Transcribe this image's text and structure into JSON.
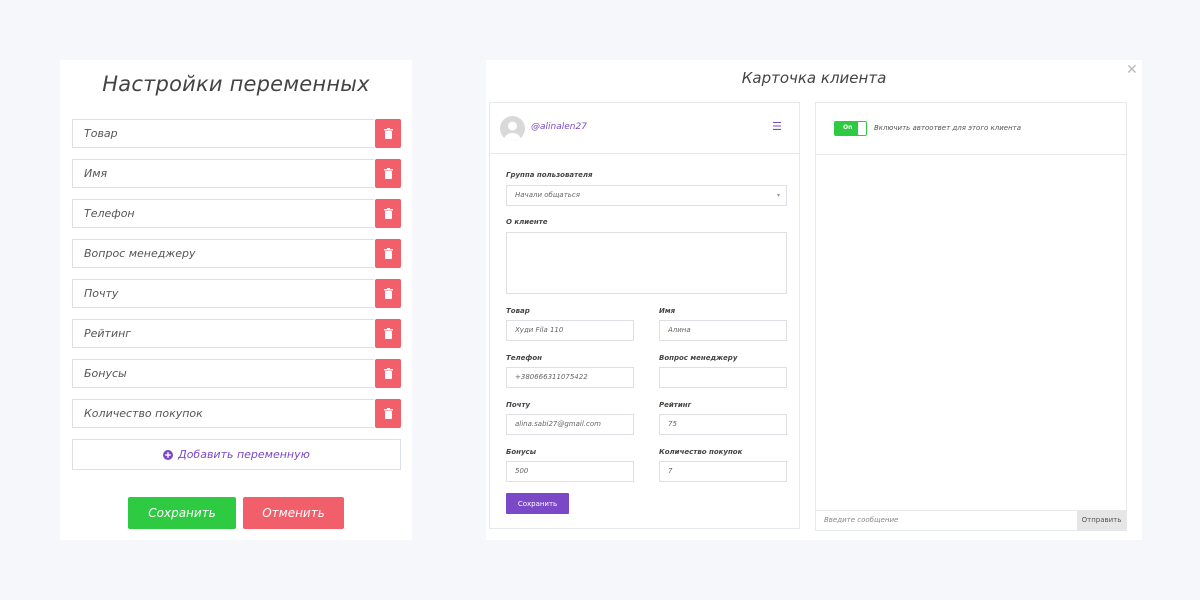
{
  "variables_panel": {
    "title": "Настройки переменных",
    "variables": [
      "Товар",
      "Имя",
      "Телефон",
      "Вопрос менеджеру",
      "Почту",
      "Рейтинг",
      "Бонусы",
      "Количество покупок"
    ],
    "add_label": "Добавить переменную",
    "save_label": "Сохранить",
    "cancel_label": "Отменить"
  },
  "client_card": {
    "title": "Карточка клиента",
    "username": "@alinalen27",
    "group_label": "Группа пользователя",
    "group_value": "Начали общаться",
    "about_label": "О клиенте",
    "fields": {
      "product_label": "Товар",
      "product_value": "Худи Fila 110",
      "name_label": "Имя",
      "name_value": "Алина",
      "phone_label": "Телефон",
      "phone_value": "+380666311075422",
      "question_label": "Вопрос менеджеру",
      "question_value": "",
      "email_label": "Почту",
      "email_value": "alina.sabi27@gmail.com",
      "rating_label": "Рейтинг",
      "rating_value": "75",
      "bonus_label": "Бонусы",
      "bonus_value": "500",
      "purchases_label": "Количество покупок",
      "purchases_value": "7"
    },
    "save_label": "Сохранить",
    "autoreply_toggle": "On",
    "autoreply_label": "Включить автоответ для этого клиента",
    "message_placeholder": "Введите сообщение",
    "send_label": "Отправить"
  },
  "colors": {
    "green": "#2dca42",
    "red": "#f05f6a",
    "purple": "#7b49c7"
  }
}
